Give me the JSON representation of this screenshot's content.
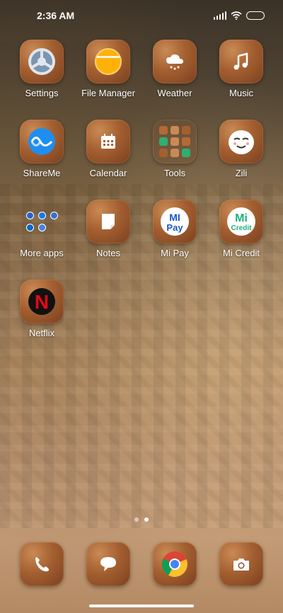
{
  "status_bar": {
    "time": "2:36 AM"
  },
  "home_apps": [
    {
      "label": "Settings",
      "icon": "settings-gear-icon"
    },
    {
      "label": "File Manager",
      "icon": "folder-icon"
    },
    {
      "label": "Weather",
      "icon": "weather-cloud-icon"
    },
    {
      "label": "Music",
      "icon": "music-note-icon"
    },
    {
      "label": "ShareMe",
      "icon": "shareme-icon"
    },
    {
      "label": "Calendar",
      "icon": "calendar-icon"
    },
    {
      "label": "Tools",
      "icon": "folder-tools-icon"
    },
    {
      "label": "Zili",
      "icon": "zili-face-icon"
    },
    {
      "label": "More apps",
      "icon": "folder-more-apps-icon"
    },
    {
      "label": "Notes",
      "icon": "notes-icon"
    },
    {
      "label": "Mi Pay",
      "icon": "mi-pay-icon",
      "icon_text": [
        "MI",
        "Pay"
      ]
    },
    {
      "label": "Mi Credit",
      "icon": "mi-credit-icon",
      "icon_text": [
        "Mi",
        "Credit"
      ]
    },
    {
      "label": "Netflix",
      "icon": "netflix-icon",
      "icon_text": [
        "N"
      ]
    }
  ],
  "page_indicator": {
    "pages": 2,
    "current": 2
  },
  "dock": [
    {
      "icon": "phone-icon"
    },
    {
      "icon": "messages-icon"
    },
    {
      "icon": "chrome-icon"
    },
    {
      "icon": "camera-icon"
    }
  ],
  "colors": {
    "icon_tile": "#a45f30",
    "text": "#ffffff",
    "netflix_red": "#e50914",
    "mi_credit_green": "#1db37a"
  }
}
